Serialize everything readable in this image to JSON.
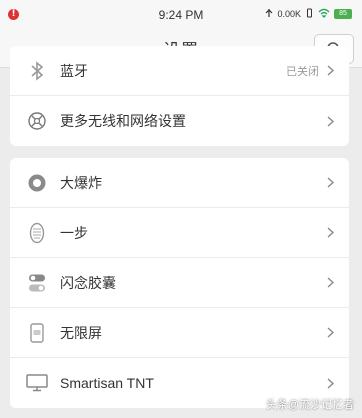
{
  "status_bar": {
    "time": "9:24 PM",
    "net_speed": "0.00K",
    "battery": "85"
  },
  "header": {
    "title": "设置",
    "search_icon": "search-icon"
  },
  "card1": {
    "items": [
      {
        "label": "蓝牙",
        "value": "已关闭",
        "icon": "bluetooth-icon"
      },
      {
        "label": "更多无线和网络设置",
        "icon": "wireless-settings-icon"
      }
    ]
  },
  "card2": {
    "items": [
      {
        "label": "大爆炸",
        "icon": "big-bang-icon"
      },
      {
        "label": "一步",
        "icon": "one-step-icon"
      },
      {
        "label": "闪念胶囊",
        "icon": "idea-capsule-icon"
      },
      {
        "label": "无限屏",
        "icon": "infinite-screen-icon"
      },
      {
        "label": "Smartisan TNT",
        "icon": "monitor-icon"
      }
    ]
  },
  "watermark": "头条@流沙记忆者",
  "colors": {
    "background": "#ececec",
    "card": "#ffffff",
    "text": "#333333",
    "secondary": "#999999",
    "battery": "#4caf50",
    "wifi": "#26a65b",
    "alert": "#dd3333"
  }
}
